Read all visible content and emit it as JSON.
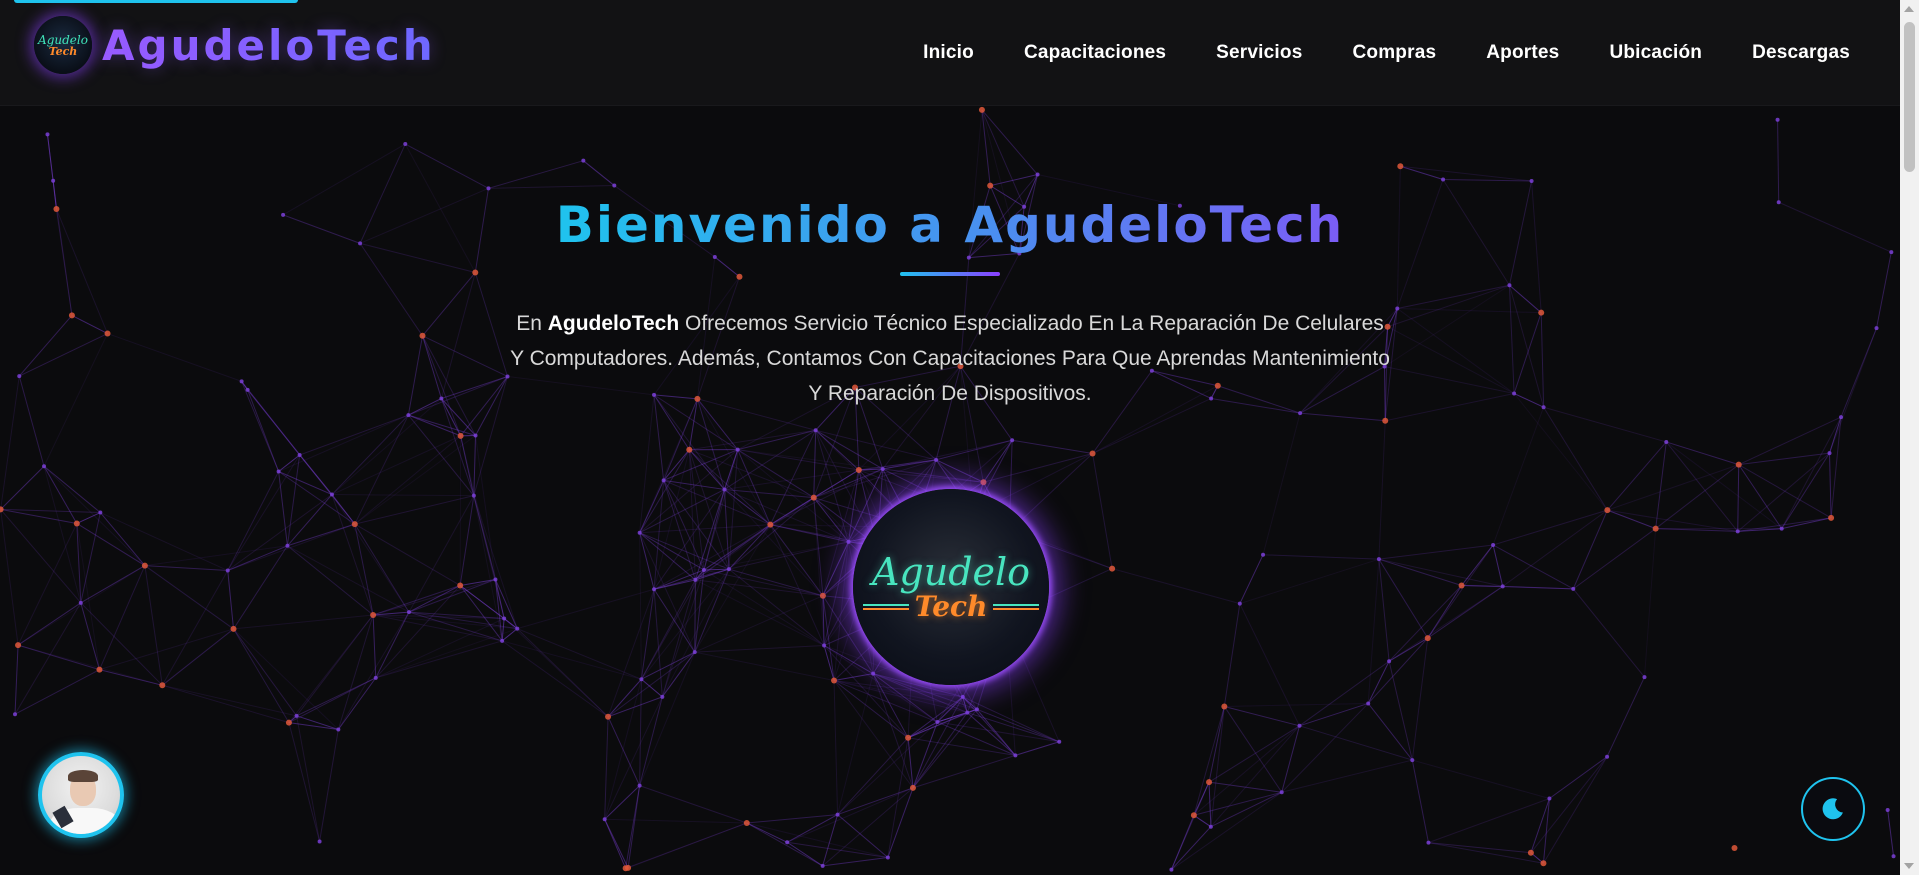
{
  "brand": {
    "name": "AgudeloTech",
    "logo_line1": "Agudelo",
    "logo_line2": "Tech"
  },
  "nav": {
    "items": [
      {
        "label": "Inicio"
      },
      {
        "label": "Capacitaciones"
      },
      {
        "label": "Servicios"
      },
      {
        "label": "Compras"
      },
      {
        "label": "Aportes"
      },
      {
        "label": "Ubicación"
      },
      {
        "label": "Descargas"
      }
    ]
  },
  "hero": {
    "title": "Bienvenido a AgudeloTech",
    "text_pre": "En ",
    "text_brand": "AgudeloTech",
    "text_post": " Ofrecemos Servicio Técnico Especializado En La Reparación De Celulares Y Computadores. Además, Contamos Con Capacitaciones Para Que Aprendas Mantenimiento Y Reparación De Dispositivos.",
    "logo_line1": "Agudelo",
    "logo_line2": "Tech"
  },
  "widgets": {
    "avatar_icon": "user-avatar-icon",
    "theme_icon": "moon-icon"
  },
  "colors": {
    "accent_cyan": "#1fc3ee",
    "accent_purple": "#8b3fff",
    "background": "#0b0b0d",
    "network_line": "#7a3fd6",
    "network_node": "#e0583a"
  }
}
